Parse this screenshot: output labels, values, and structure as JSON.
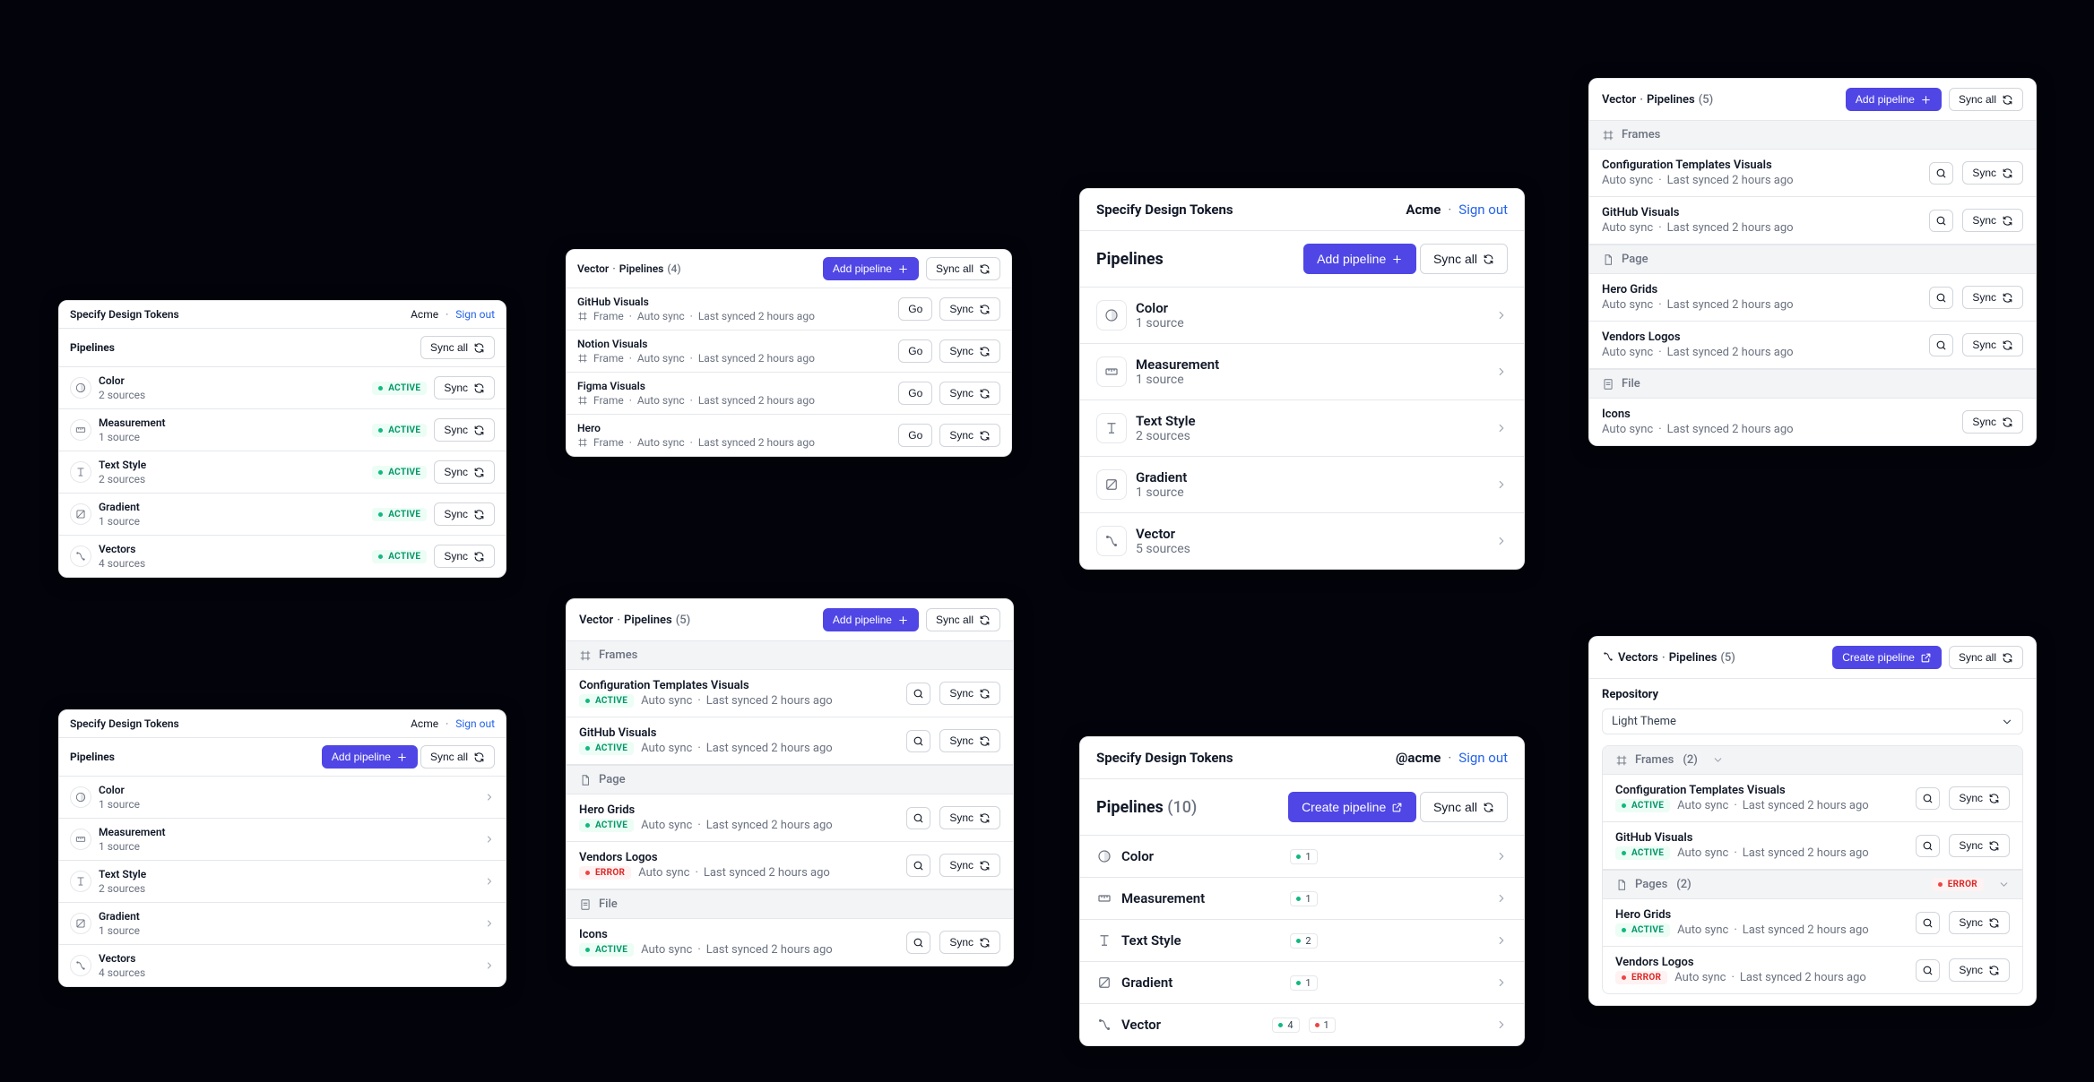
{
  "labels": {
    "pipelines": "Pipelines",
    "sync_all": "Sync all",
    "add_pipeline": "Add pipeline",
    "create_pipeline": "Create pipeline",
    "sign_out": "Sign out",
    "go": "Go",
    "sync": "Sync",
    "repository": "Repository",
    "auto_sync": "Auto sync",
    "last_synced_2h": "Last synced 2 hours ago",
    "frames": "Frames",
    "page": "Page",
    "pages": "Pages",
    "file": "File",
    "frame": "Frame",
    "active": "ACTIVE",
    "error": "ERROR"
  },
  "sections": {
    "vectors": "Vectors",
    "vector": "Vector"
  },
  "app_title": "Specify Design Tokens",
  "card1": {
    "org": "Acme",
    "rows": [
      {
        "name": "Color",
        "sub": "2 sources"
      },
      {
        "name": "Measurement",
        "sub": "1 source"
      },
      {
        "name": "Text Style",
        "sub": "2 sources"
      },
      {
        "name": "Gradient",
        "sub": "1 source"
      },
      {
        "name": "Vectors",
        "sub": "4 sources"
      }
    ]
  },
  "card2": {
    "org": "Acme",
    "rows": [
      {
        "name": "Color",
        "sub": "1 source"
      },
      {
        "name": "Measurement",
        "sub": "1 source"
      },
      {
        "name": "Text Style",
        "sub": "2 sources"
      },
      {
        "name": "Gradient",
        "sub": "1 source"
      },
      {
        "name": "Vectors",
        "sub": "4 sources"
      }
    ]
  },
  "card3": {
    "count": "(4)",
    "rows": [
      {
        "name": "GitHub Visuals"
      },
      {
        "name": "Notion Visuals"
      },
      {
        "name": "Figma Visuals"
      },
      {
        "name": "Hero"
      }
    ]
  },
  "card4": {
    "count": "(5)",
    "rows": {
      "frames": [
        {
          "name": "Configuration Templates Visuals",
          "status": "active"
        },
        {
          "name": "GitHub Visuals",
          "status": "active"
        }
      ],
      "page": [
        {
          "name": "Hero Grids",
          "status": "active"
        },
        {
          "name": "Vendors Logos",
          "status": "error"
        }
      ],
      "file": [
        {
          "name": "Icons",
          "status": "active"
        }
      ]
    }
  },
  "card5": {
    "org": "Acme",
    "rows": [
      {
        "name": "Color",
        "sub": "1 source"
      },
      {
        "name": "Measurement",
        "sub": "1 source"
      },
      {
        "name": "Text Style",
        "sub": "2 sources"
      },
      {
        "name": "Gradient",
        "sub": "1 source"
      },
      {
        "name": "Vector",
        "sub": "5 sources"
      }
    ]
  },
  "card6": {
    "org": "@acme",
    "count": "(10)",
    "rows": [
      {
        "name": "Color",
        "n": "1"
      },
      {
        "name": "Measurement",
        "n": "1"
      },
      {
        "name": "Text Style",
        "n": "2"
      },
      {
        "name": "Gradient",
        "n": "1"
      },
      {
        "name": "Vector",
        "n": "4",
        "err": "1"
      }
    ]
  },
  "card7": {
    "count": "(5)",
    "rows": {
      "frames": [
        {
          "name": "Configuration Templates Visuals"
        },
        {
          "name": "GitHub Visuals"
        }
      ],
      "page": [
        {
          "name": "Hero Grids"
        },
        {
          "name": "Vendors Logos"
        }
      ],
      "file": [
        {
          "name": "Icons"
        }
      ]
    }
  },
  "card8": {
    "count": "(5)",
    "repo": "Light Theme",
    "frames_n": "(2)",
    "pages_n": "(2)",
    "rows": {
      "frames": [
        {
          "name": "Configuration Templates Visuals",
          "status": "active"
        },
        {
          "name": "GitHub Visuals",
          "status": "active"
        }
      ],
      "pages": [
        {
          "name": "Hero Grids",
          "status": "active"
        },
        {
          "name": "Vendors Logos",
          "status": "error"
        }
      ]
    }
  }
}
